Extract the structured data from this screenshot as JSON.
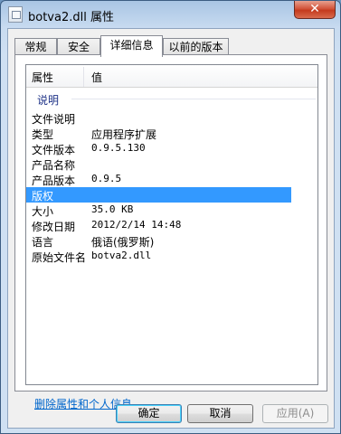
{
  "window": {
    "title": "botva2.dll 属性",
    "close_glyph": "✕"
  },
  "tabs": [
    {
      "label": "常规"
    },
    {
      "label": "安全"
    },
    {
      "label": "详细信息"
    },
    {
      "label": "以前的版本"
    }
  ],
  "active_tab": "详细信息",
  "table": {
    "headers": {
      "property": "属性",
      "value": "值"
    },
    "group": "说明",
    "rows": [
      {
        "name": "文件说明",
        "value": ""
      },
      {
        "name": "类型",
        "value": "应用程序扩展"
      },
      {
        "name": "文件版本",
        "value": "0.9.5.130"
      },
      {
        "name": "产品名称",
        "value": ""
      },
      {
        "name": "产品版本",
        "value": "0.9.5"
      },
      {
        "name": "版权",
        "value": ""
      },
      {
        "name": "大小",
        "value": "35.0 KB"
      },
      {
        "name": "修改日期",
        "value": "2012/2/14 14:48"
      },
      {
        "name": "语言",
        "value": "俄语(俄罗斯)"
      },
      {
        "name": "原始文件名",
        "value": "botva2.dll"
      }
    ],
    "selected_row": "版权"
  },
  "remove_link": "删除属性和个人信息",
  "buttons": {
    "ok": "确定",
    "cancel": "取消",
    "apply": "应用(A)"
  },
  "colors": {
    "selection": "#3399ff",
    "link": "#0066cc",
    "group_label": "#1e3287"
  }
}
